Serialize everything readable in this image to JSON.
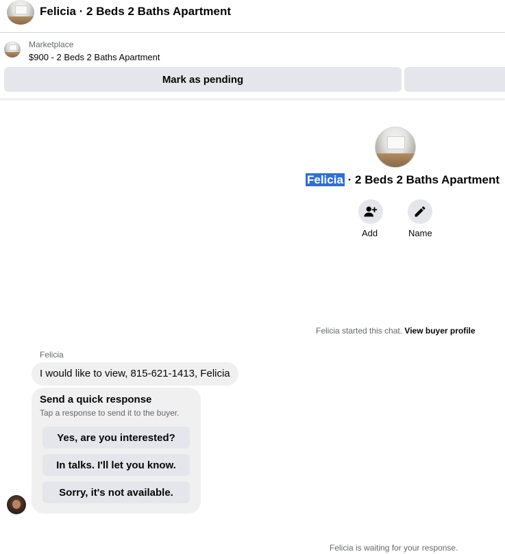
{
  "header": {
    "title": "Felicia · 2 Beds 2 Baths Apartment"
  },
  "listing": {
    "source": "Marketplace",
    "price_title": "$900 - 2 Beds 2 Baths Apartment",
    "pending_label": "Mark as pending",
    "second_label": ""
  },
  "profile": {
    "name": "Felicia",
    "title_rest": " · 2 Beds 2 Baths Apartment",
    "add_label": "Add",
    "name_label": "Name"
  },
  "chat_started": {
    "text": "Felicia started this chat.",
    "link": "View buyer profile"
  },
  "message": {
    "sender": "Felicia",
    "text": "I would like to view, 815-621-1413, Felicia"
  },
  "quick_response": {
    "title": "Send a quick response",
    "subtitle": "Tap a response to send it to the buyer.",
    "options": [
      "Yes, are you interested?",
      "In talks. I'll let you know.",
      "Sorry, it's not available."
    ]
  },
  "waiting": "Felicia is waiting for your response."
}
